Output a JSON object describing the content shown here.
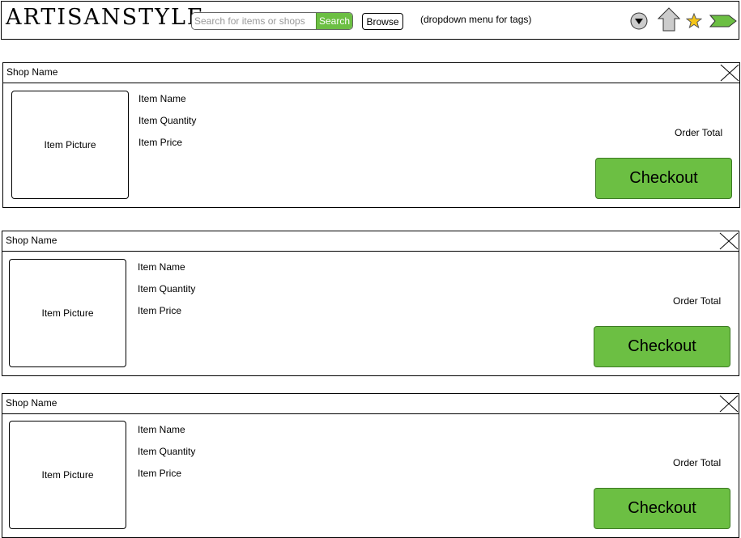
{
  "header": {
    "logo": "ARTISANSTYLE",
    "search_placeholder": "Search for items or shops",
    "search_label": "Search",
    "browse_label": "Browse",
    "dropdown_note": "(dropdown menu for tags)",
    "icons": [
      "dropdown-icon",
      "home-icon",
      "star-icon",
      "arrow-right-icon"
    ],
    "colors": {
      "accent_green": "#6cbf43",
      "star_yellow": "#f5c518",
      "icon_gray": "#cccccc"
    }
  },
  "orders": [
    {
      "shop_name": "Shop Name",
      "item_picture": "Item Picture",
      "item_name": "Item Name",
      "item_quantity": "Item Quantity",
      "item_price": "Item Price",
      "order_total": "Order Total",
      "checkout_label": "Checkout"
    },
    {
      "shop_name": "Shop Name",
      "item_picture": "Item Picture",
      "item_name": "Item Name",
      "item_quantity": "Item Quantity",
      "item_price": "Item Price",
      "order_total": "Order Total",
      "checkout_label": "Checkout"
    },
    {
      "shop_name": "Shop Name",
      "item_picture": "Item Picture",
      "item_name": "Item Name",
      "item_quantity": "Item Quantity",
      "item_price": "Item Price",
      "order_total": "Order Total",
      "checkout_label": "Checkout"
    }
  ]
}
